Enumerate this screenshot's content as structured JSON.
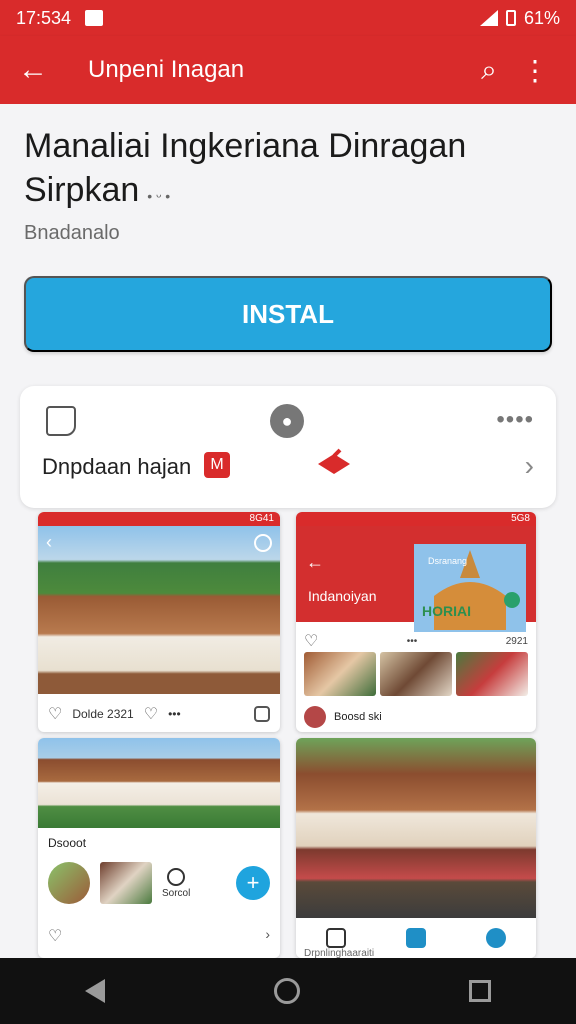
{
  "status_bar": {
    "time": "17:534",
    "battery_text": "61%"
  },
  "app_bar": {
    "back_icon": "arrow-left-icon",
    "title": "Unpeni Inagan",
    "search_icon": "search-icon",
    "menu_icon": "more-vert-icon"
  },
  "details": {
    "title_line1": "Manaliai Ingkeriana Dinragan",
    "title_line2": "Sirpkan",
    "title_emoji": "• ᵕ •",
    "developer": "Bnadanalo",
    "install_label": "INSTAL"
  },
  "info_card": {
    "label": "Dnpdaan hajan",
    "more": "••••",
    "flag_glyph": "M"
  },
  "screens": {
    "s1_status": "8G41",
    "s1_action_a": "Dolde 2321",
    "s1_action_b": "•••",
    "s2_status": "5G8",
    "s2_title": "Dsranang",
    "s2_subtitle": "Indanoiyan",
    "s2_banner": "HORIAI",
    "s2_row": [
      "•••",
      "2921"
    ],
    "s2_author": "Boosd ski",
    "s3_title": "Dsooot",
    "s3_mid": "Sorcol",
    "s3_fab": "+",
    "s4_caption": "Drpnlinghaaraiti"
  },
  "nav_bar": {
    "back_icon": "nav-back-icon",
    "home_icon": "nav-home-icon",
    "recent_icon": "nav-recent-icon"
  },
  "colors": {
    "brand_red": "#d92b2b",
    "install_blue": "#25a6dd",
    "nav_bg": "#111111"
  }
}
